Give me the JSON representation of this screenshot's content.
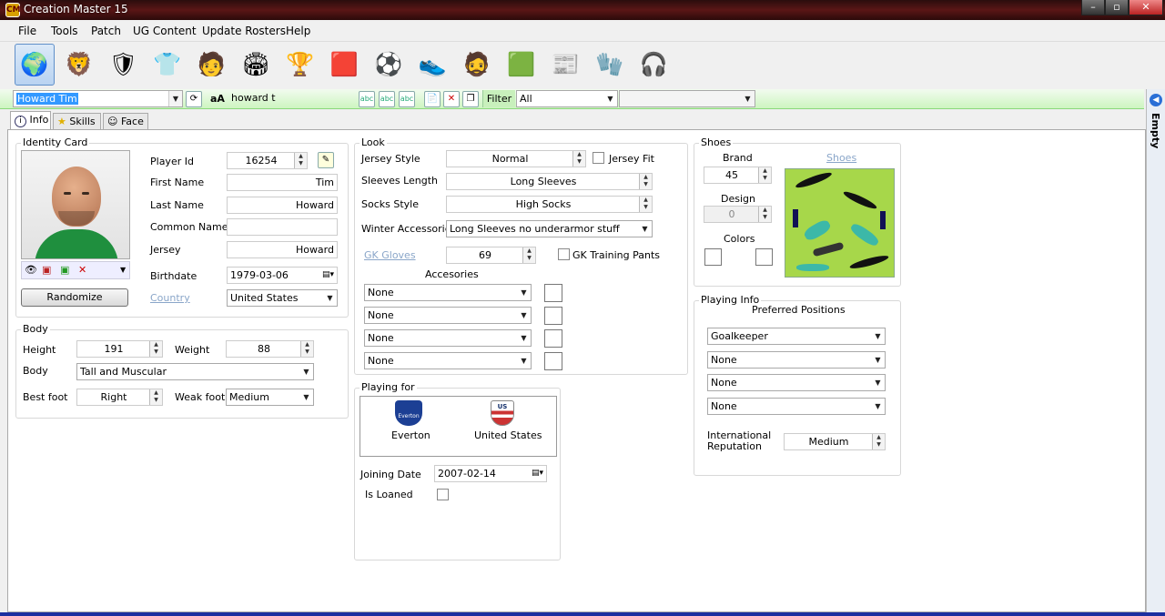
{
  "window": {
    "title": "Creation Master 15",
    "app_icon_text": "CM"
  },
  "menu": [
    "File",
    "Tools",
    "Patch",
    "UG Content",
    "Update Rosters",
    "Help"
  ],
  "toolbar_icons": [
    {
      "name": "world-icon",
      "glyph": "🌍"
    },
    {
      "name": "premier-league-icon",
      "glyph": "🦁"
    },
    {
      "name": "club-crest-icon",
      "glyph": "🛡"
    },
    {
      "name": "kit-shirt-icon",
      "glyph": "👕"
    },
    {
      "name": "player-face-icon",
      "glyph": "🧑"
    },
    {
      "name": "stadium-icon",
      "glyph": "🏟"
    },
    {
      "name": "trophy-icon",
      "glyph": "🏆"
    },
    {
      "name": "referee-cards-icon",
      "glyph": "🟥"
    },
    {
      "name": "ball-icon",
      "glyph": "⚽"
    },
    {
      "name": "boots-icon",
      "glyph": "👟"
    },
    {
      "name": "manager-icon",
      "glyph": "🧔"
    },
    {
      "name": "pitch-icon",
      "glyph": "🟩"
    },
    {
      "name": "newspaper-icon",
      "glyph": "📰"
    },
    {
      "name": "gloves-icon",
      "glyph": "🧤"
    },
    {
      "name": "headphones-icon",
      "glyph": "🎧"
    }
  ],
  "filterbar": {
    "player_select": "Howard Tim",
    "search_text": "howard t",
    "filter_label": "Filter",
    "filter_value": "All",
    "filter_value2": "",
    "case_icon_text": "aA"
  },
  "tabs": [
    "Info",
    "Skills",
    "Face"
  ],
  "side_panel": {
    "label": "Empty"
  },
  "identity": {
    "legend": "Identity Card",
    "player_id_label": "Player Id",
    "player_id": "16254",
    "first_name_label": "First Name",
    "first_name": "Tim",
    "last_name_label": "Last Name",
    "last_name": "Howard",
    "common_name_label": "Common Name",
    "common_name": "",
    "jersey_label": "Jersey",
    "jersey": "Howard",
    "birthdate_label": "Birthdate",
    "birthdate": "1979-03-06",
    "country_label": "Country",
    "country": "United States",
    "randomize": "Randomize"
  },
  "body": {
    "legend": "Body",
    "height_label": "Height",
    "height": "191",
    "weight_label": "Weight",
    "weight": "88",
    "body_label": "Body",
    "body": "Tall and Muscular",
    "best_foot_label": "Best foot",
    "best_foot": "Right",
    "weak_foot_label": "Weak foot",
    "weak_foot": "Medium"
  },
  "look": {
    "legend": "Look",
    "jersey_style_label": "Jersey Style",
    "jersey_style": "Normal",
    "jersey_fit_label": "Jersey Fit",
    "sleeves_label": "Sleeves Length",
    "sleeves": "Long Sleeves",
    "socks_label": "Socks Style",
    "socks": "High Socks",
    "winter_label": "Winter Accessories",
    "winter": "Long Sleeves no underarmor stuff",
    "gk_gloves_label": "GK Gloves",
    "gk_gloves": "69",
    "gk_pants_label": "GK Training Pants",
    "accessories_label": "Accesories",
    "accessories": [
      "None",
      "None",
      "None",
      "None"
    ]
  },
  "playing_for": {
    "legend": "Playing for",
    "club": "Everton",
    "club_badge": "Everton",
    "nation": "United States",
    "nation_badge": "US",
    "joining_label": "Joining Date",
    "joining": "2007-02-14",
    "loaned_label": "Is Loaned"
  },
  "shoes": {
    "legend": "Shoes",
    "brand_label": "Brand",
    "brand": "45",
    "design_label": "Design",
    "design": "0",
    "colors_label": "Colors",
    "preview_link": "Shoes"
  },
  "playing_info": {
    "legend": "Playing Info",
    "positions_label": "Preferred Positions",
    "positions": [
      "Goalkeeper",
      "None",
      "None",
      "None"
    ],
    "reputation_label": "International Reputation",
    "reputation": "Medium"
  }
}
